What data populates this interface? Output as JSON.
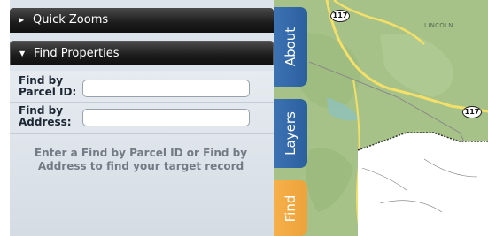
{
  "panel": {
    "quick_zooms": {
      "label": "Quick Zooms",
      "icon": "triangle-right-icon",
      "expanded": false
    },
    "find_properties": {
      "label": "Find Properties",
      "icon": "triangle-down-icon",
      "expanded": true
    }
  },
  "form": {
    "parcel": {
      "label": "Find by Parcel ID:",
      "value": ""
    },
    "address": {
      "label": "Find by Address:",
      "value": ""
    },
    "hint": "Enter a Find by Parcel ID or Find by Address to find your target record"
  },
  "map": {
    "town_label": "LINCOLN",
    "route_shields": [
      "117",
      "117"
    ]
  },
  "tabs": [
    {
      "label": "About",
      "color": "#356aa8"
    },
    {
      "label": "Layers",
      "color": "#356aa8"
    },
    {
      "label": "Find",
      "color": "#f3aa45"
    }
  ]
}
